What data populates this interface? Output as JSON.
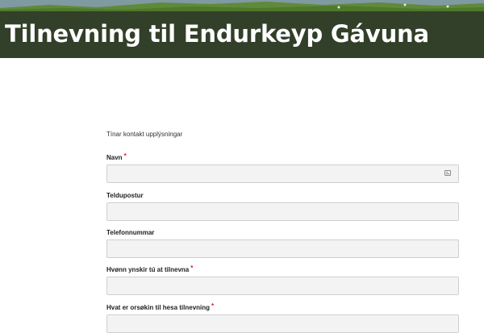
{
  "header": {
    "title": "Tilnevning til Endurkeyp Gávuna"
  },
  "form": {
    "section_heading": "Tínar kontakt upplýsningar",
    "required_marker": "*",
    "fields": [
      {
        "label": "Navn",
        "required": true,
        "value": "",
        "icon": "contact-card-icon"
      },
      {
        "label": "Teldupostur",
        "required": false,
        "value": ""
      },
      {
        "label": "Telefonnummar",
        "required": false,
        "value": ""
      },
      {
        "label": "Hvønn ynskir tú at tilnevna",
        "required": true,
        "value": ""
      },
      {
        "label": "Hvat er orsøkin til hesa tilnevning",
        "required": true,
        "value": ""
      }
    ]
  },
  "colors": {
    "title_band": "#2f2f2f",
    "required": "#cc2222",
    "input_bg": "#f3f3f3",
    "input_border": "#cfcfcf"
  }
}
